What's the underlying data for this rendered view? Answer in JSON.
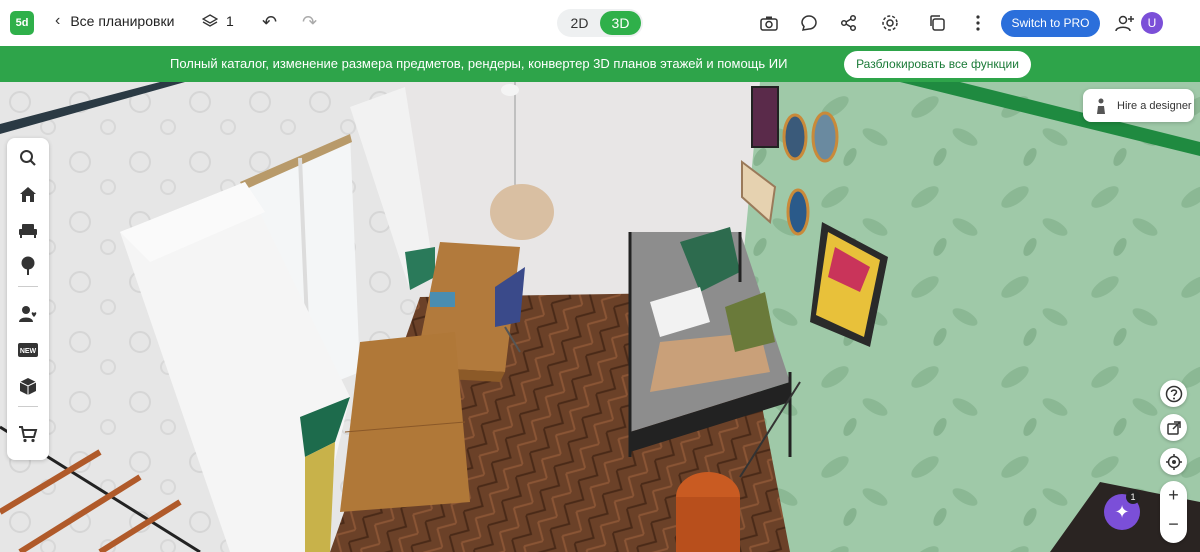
{
  "header": {
    "logo_text": "5d",
    "back_label": "Все планировки",
    "floors_count": "1",
    "view_2d": "2D",
    "view_3d": "3D",
    "active_view": "3D",
    "pro_button": "Switch to PRO",
    "avatar_letter": "U",
    "icons": [
      "camera-icon",
      "comment-icon",
      "share-icon",
      "settings-icon",
      "copy-icon",
      "more-icon",
      "add-user-icon"
    ]
  },
  "banner": {
    "text": "Полный каталог, изменение размера предметов, рендеры, конвертер 3D планов этажей и помощь ИИ",
    "button": "Разблокировать все функции",
    "color": "#2ea44a"
  },
  "left_tools": [
    "search-icon",
    "house-icon",
    "sofa-icon",
    "tree-icon",
    "user-heart-icon",
    "new-badge-icon",
    "box-icon",
    "cart-icon"
  ],
  "right_panel": {
    "hire_label": "Hire a designer",
    "zoom_in": "+",
    "zoom_out": "−",
    "ai_badge": "1"
  },
  "colors": {
    "accent": "#2fb04a",
    "pro_blue": "#2b6fdb",
    "avatar_purple": "#7b4fd8"
  }
}
